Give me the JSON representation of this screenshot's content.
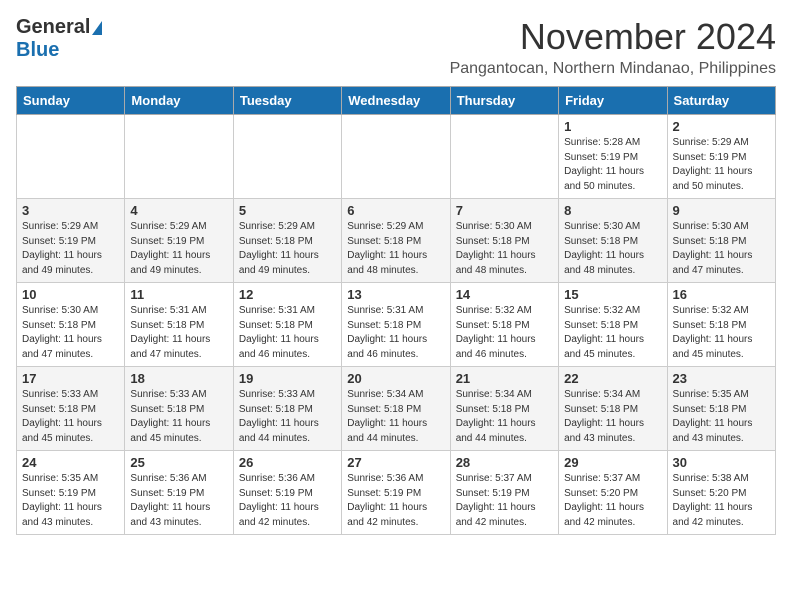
{
  "header": {
    "logo_line1": "General",
    "logo_line2": "Blue",
    "month": "November 2024",
    "location": "Pangantocan, Northern Mindanao, Philippines"
  },
  "weekdays": [
    "Sunday",
    "Monday",
    "Tuesday",
    "Wednesday",
    "Thursday",
    "Friday",
    "Saturday"
  ],
  "weeks": [
    [
      {
        "day": "",
        "info": ""
      },
      {
        "day": "",
        "info": ""
      },
      {
        "day": "",
        "info": ""
      },
      {
        "day": "",
        "info": ""
      },
      {
        "day": "",
        "info": ""
      },
      {
        "day": "1",
        "info": "Sunrise: 5:28 AM\nSunset: 5:19 PM\nDaylight: 11 hours\nand 50 minutes."
      },
      {
        "day": "2",
        "info": "Sunrise: 5:29 AM\nSunset: 5:19 PM\nDaylight: 11 hours\nand 50 minutes."
      }
    ],
    [
      {
        "day": "3",
        "info": "Sunrise: 5:29 AM\nSunset: 5:19 PM\nDaylight: 11 hours\nand 49 minutes."
      },
      {
        "day": "4",
        "info": "Sunrise: 5:29 AM\nSunset: 5:19 PM\nDaylight: 11 hours\nand 49 minutes."
      },
      {
        "day": "5",
        "info": "Sunrise: 5:29 AM\nSunset: 5:18 PM\nDaylight: 11 hours\nand 49 minutes."
      },
      {
        "day": "6",
        "info": "Sunrise: 5:29 AM\nSunset: 5:18 PM\nDaylight: 11 hours\nand 48 minutes."
      },
      {
        "day": "7",
        "info": "Sunrise: 5:30 AM\nSunset: 5:18 PM\nDaylight: 11 hours\nand 48 minutes."
      },
      {
        "day": "8",
        "info": "Sunrise: 5:30 AM\nSunset: 5:18 PM\nDaylight: 11 hours\nand 48 minutes."
      },
      {
        "day": "9",
        "info": "Sunrise: 5:30 AM\nSunset: 5:18 PM\nDaylight: 11 hours\nand 47 minutes."
      }
    ],
    [
      {
        "day": "10",
        "info": "Sunrise: 5:30 AM\nSunset: 5:18 PM\nDaylight: 11 hours\nand 47 minutes."
      },
      {
        "day": "11",
        "info": "Sunrise: 5:31 AM\nSunset: 5:18 PM\nDaylight: 11 hours\nand 47 minutes."
      },
      {
        "day": "12",
        "info": "Sunrise: 5:31 AM\nSunset: 5:18 PM\nDaylight: 11 hours\nand 46 minutes."
      },
      {
        "day": "13",
        "info": "Sunrise: 5:31 AM\nSunset: 5:18 PM\nDaylight: 11 hours\nand 46 minutes."
      },
      {
        "day": "14",
        "info": "Sunrise: 5:32 AM\nSunset: 5:18 PM\nDaylight: 11 hours\nand 46 minutes."
      },
      {
        "day": "15",
        "info": "Sunrise: 5:32 AM\nSunset: 5:18 PM\nDaylight: 11 hours\nand 45 minutes."
      },
      {
        "day": "16",
        "info": "Sunrise: 5:32 AM\nSunset: 5:18 PM\nDaylight: 11 hours\nand 45 minutes."
      }
    ],
    [
      {
        "day": "17",
        "info": "Sunrise: 5:33 AM\nSunset: 5:18 PM\nDaylight: 11 hours\nand 45 minutes."
      },
      {
        "day": "18",
        "info": "Sunrise: 5:33 AM\nSunset: 5:18 PM\nDaylight: 11 hours\nand 45 minutes."
      },
      {
        "day": "19",
        "info": "Sunrise: 5:33 AM\nSunset: 5:18 PM\nDaylight: 11 hours\nand 44 minutes."
      },
      {
        "day": "20",
        "info": "Sunrise: 5:34 AM\nSunset: 5:18 PM\nDaylight: 11 hours\nand 44 minutes."
      },
      {
        "day": "21",
        "info": "Sunrise: 5:34 AM\nSunset: 5:18 PM\nDaylight: 11 hours\nand 44 minutes."
      },
      {
        "day": "22",
        "info": "Sunrise: 5:34 AM\nSunset: 5:18 PM\nDaylight: 11 hours\nand 43 minutes."
      },
      {
        "day": "23",
        "info": "Sunrise: 5:35 AM\nSunset: 5:18 PM\nDaylight: 11 hours\nand 43 minutes."
      }
    ],
    [
      {
        "day": "24",
        "info": "Sunrise: 5:35 AM\nSunset: 5:19 PM\nDaylight: 11 hours\nand 43 minutes."
      },
      {
        "day": "25",
        "info": "Sunrise: 5:36 AM\nSunset: 5:19 PM\nDaylight: 11 hours\nand 43 minutes."
      },
      {
        "day": "26",
        "info": "Sunrise: 5:36 AM\nSunset: 5:19 PM\nDaylight: 11 hours\nand 42 minutes."
      },
      {
        "day": "27",
        "info": "Sunrise: 5:36 AM\nSunset: 5:19 PM\nDaylight: 11 hours\nand 42 minutes."
      },
      {
        "day": "28",
        "info": "Sunrise: 5:37 AM\nSunset: 5:19 PM\nDaylight: 11 hours\nand 42 minutes."
      },
      {
        "day": "29",
        "info": "Sunrise: 5:37 AM\nSunset: 5:20 PM\nDaylight: 11 hours\nand 42 minutes."
      },
      {
        "day": "30",
        "info": "Sunrise: 5:38 AM\nSunset: 5:20 PM\nDaylight: 11 hours\nand 42 minutes."
      }
    ]
  ]
}
